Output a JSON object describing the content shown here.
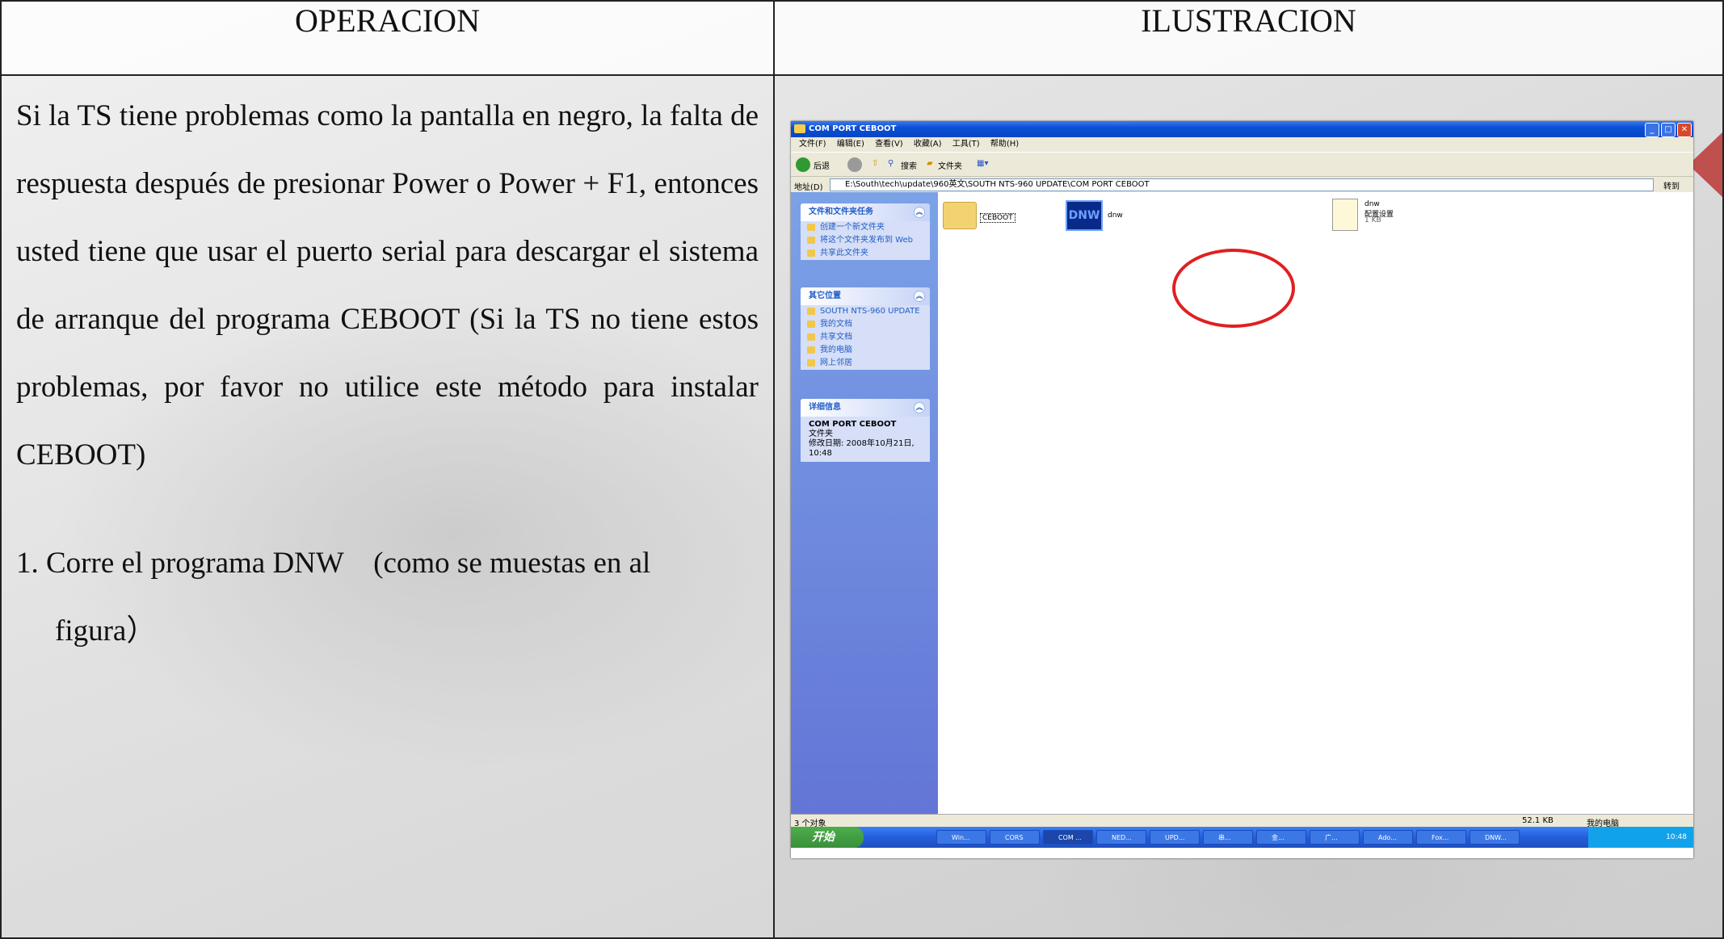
{
  "headers": {
    "left": "OPERACION",
    "right": "ILUSTRACION"
  },
  "paragraph": "Si la TS tiene problemas como la pantalla en negro, la falta de respuesta después de presionar Power o Power + F1, entonces usted tiene que usar el puerto serial para descargar el sistema de arranque del programa CEBOOT (Si la TS no tiene estos problemas, por favor no utilice este método para instalar CEBOOT)",
  "step": {
    "number": "1.",
    "line1": "Corre el programa DNW　(como se muestas en al",
    "line2": "figura）"
  },
  "screenshot": {
    "title": "COM PORT CEBOOT",
    "menu": [
      "文件(F)",
      "编辑(E)",
      "查看(V)",
      "收藏(A)",
      "工具(T)",
      "帮助(H)"
    ],
    "toolbar": {
      "back": "后退",
      "search": "搜索",
      "folders": "文件夹"
    },
    "address": {
      "label": "地址(D)",
      "path": "E:\\South\\tech\\update\\960英文\\SOUTH NTS-960 UPDATE\\COM PORT CEBOOT",
      "go": "转到"
    },
    "tasks_panel": {
      "title": "文件和文件夹任务",
      "items": [
        "创建一个新文件夹",
        "将这个文件夹发布到 Web",
        "共享此文件夹"
      ]
    },
    "places_panel": {
      "title": "其它位置",
      "items": [
        "SOUTH NTS-960 UPDATE",
        "我的文档",
        "共享文档",
        "我的电脑",
        "网上邻居"
      ]
    },
    "details_panel": {
      "title": "详细信息",
      "name": "COM PORT CEBOOT",
      "type": "文件夹",
      "modified": "修改日期: 2008年10月21日, 10:48"
    },
    "files": [
      {
        "name": "CEBOOT",
        "icon": "folder-icon"
      },
      {
        "name": "dnw",
        "icon": "dnw-app-icon",
        "icon_text": "DNW"
      },
      {
        "name": "dnw",
        "sub1": "配置设置",
        "sub2": "1 KB",
        "icon": "config-file-icon"
      }
    ],
    "status": {
      "objects": "3 个对象",
      "size": "52.1 KB",
      "location": "我的电脑"
    },
    "taskbar": {
      "start": "开始",
      "items": [
        "Win...",
        "CORS",
        "COM ...",
        "NED...",
        "UPD...",
        "串...",
        "金...",
        "广...",
        "Ado...",
        "Fox...",
        "DNW..."
      ],
      "time": "10:48"
    }
  }
}
